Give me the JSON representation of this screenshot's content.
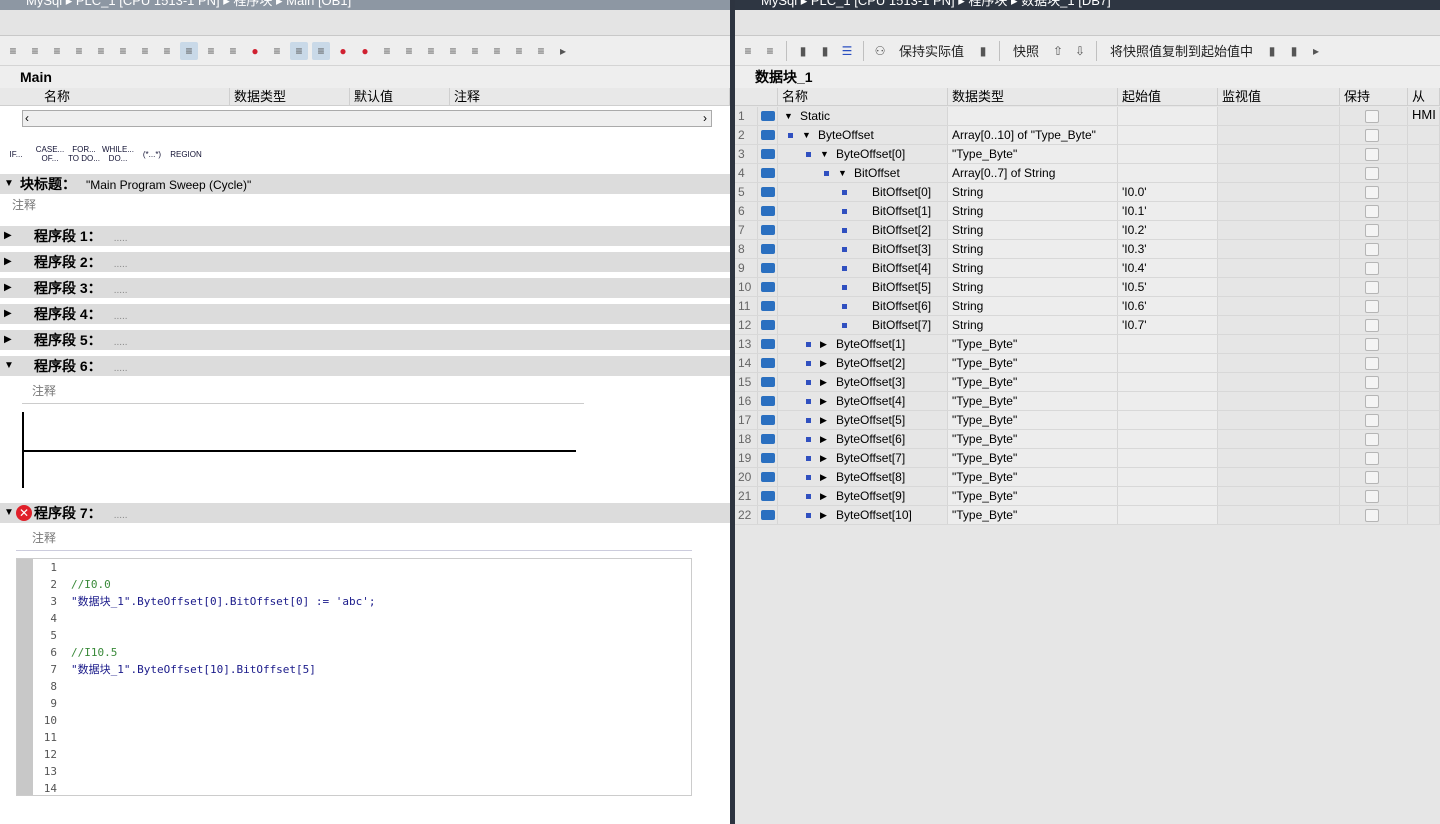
{
  "left": {
    "title": "MySql ▸ PLC_1 [CPU 1513-1 PN] ▸ 程序块 ▸ Main [OB1]",
    "block_name": "Main",
    "interface_headers": [
      "名称",
      "数据类型",
      "默认值",
      "注释"
    ],
    "snippets": [
      "IF...",
      "CASE... OF...",
      "FOR... TO DO...",
      "WHILE... DO...",
      "(*...*)",
      "REGION"
    ],
    "block_title_label": "块标题：",
    "block_title_value": "\"Main Program Sweep (Cycle)\"",
    "comment": "注释",
    "networks": [
      {
        "label": "程序段 1：",
        "dots": "....."
      },
      {
        "label": "程序段 2：",
        "dots": "....."
      },
      {
        "label": "程序段 3：",
        "dots": "....."
      },
      {
        "label": "程序段 4：",
        "dots": "....."
      },
      {
        "label": "程序段 5：",
        "dots": "....."
      },
      {
        "label": "程序段 6：",
        "dots": "....."
      },
      {
        "label": "程序段 7：",
        "dots": "....."
      }
    ],
    "code_lines": [
      "",
      "//I0.0",
      "\"数据块_1\".ByteOffset[0].BitOffset[0] := 'abc';",
      "",
      "",
      "//I10.5",
      "\"数据块_1\".ByteOffset[10].BitOffset[5]",
      "",
      "",
      "",
      "",
      "",
      "",
      ""
    ]
  },
  "right": {
    "title": "MySql ▸ PLC_1 [CPU 1513-1 PN] ▸ 程序块 ▸ 数据块_1 [DB7]",
    "block_name": "数据块_1",
    "toolbar_labels": {
      "keep_actual": "保持实际值",
      "snapshot": "快照",
      "copy_snapshot": "将快照值复制到起始值中"
    },
    "headers": [
      "名称",
      "数据类型",
      "起始值",
      "监视值",
      "保持",
      "从 HMI"
    ],
    "rows": [
      {
        "n": "1",
        "name": "Static",
        "type": "",
        "start": "",
        "lvl": 0,
        "exp": "down",
        "sq": false
      },
      {
        "n": "2",
        "name": "ByteOffset",
        "type": "Array[0..10] of \"Type_Byte\"",
        "start": "",
        "lvl": 1,
        "exp": "down",
        "sq": true
      },
      {
        "n": "3",
        "name": "ByteOffset[0]",
        "type": "\"Type_Byte\"",
        "start": "",
        "lvl": 2,
        "exp": "down",
        "sq": true
      },
      {
        "n": "4",
        "name": "BitOffset",
        "type": "Array[0..7] of String",
        "start": "",
        "lvl": 3,
        "exp": "down",
        "sq": true
      },
      {
        "n": "5",
        "name": "BitOffset[0]",
        "type": "String",
        "start": "'I0.0'",
        "lvl": 4,
        "exp": "",
        "sq": true
      },
      {
        "n": "6",
        "name": "BitOffset[1]",
        "type": "String",
        "start": "'I0.1'",
        "lvl": 4,
        "exp": "",
        "sq": true
      },
      {
        "n": "7",
        "name": "BitOffset[2]",
        "type": "String",
        "start": "'I0.2'",
        "lvl": 4,
        "exp": "",
        "sq": true
      },
      {
        "n": "8",
        "name": "BitOffset[3]",
        "type": "String",
        "start": "'I0.3'",
        "lvl": 4,
        "exp": "",
        "sq": true
      },
      {
        "n": "9",
        "name": "BitOffset[4]",
        "type": "String",
        "start": "'I0.4'",
        "lvl": 4,
        "exp": "",
        "sq": true
      },
      {
        "n": "10",
        "name": "BitOffset[5]",
        "type": "String",
        "start": "'I0.5'",
        "lvl": 4,
        "exp": "",
        "sq": true
      },
      {
        "n": "11",
        "name": "BitOffset[6]",
        "type": "String",
        "start": "'I0.6'",
        "lvl": 4,
        "exp": "",
        "sq": true
      },
      {
        "n": "12",
        "name": "BitOffset[7]",
        "type": "String",
        "start": "'I0.7'",
        "lvl": 4,
        "exp": "",
        "sq": true
      },
      {
        "n": "13",
        "name": "ByteOffset[1]",
        "type": "\"Type_Byte\"",
        "start": "",
        "lvl": 2,
        "exp": "right",
        "sq": true
      },
      {
        "n": "14",
        "name": "ByteOffset[2]",
        "type": "\"Type_Byte\"",
        "start": "",
        "lvl": 2,
        "exp": "right",
        "sq": true
      },
      {
        "n": "15",
        "name": "ByteOffset[3]",
        "type": "\"Type_Byte\"",
        "start": "",
        "lvl": 2,
        "exp": "right",
        "sq": true
      },
      {
        "n": "16",
        "name": "ByteOffset[4]",
        "type": "\"Type_Byte\"",
        "start": "",
        "lvl": 2,
        "exp": "right",
        "sq": true
      },
      {
        "n": "17",
        "name": "ByteOffset[5]",
        "type": "\"Type_Byte\"",
        "start": "",
        "lvl": 2,
        "exp": "right",
        "sq": true
      },
      {
        "n": "18",
        "name": "ByteOffset[6]",
        "type": "\"Type_Byte\"",
        "start": "",
        "lvl": 2,
        "exp": "right",
        "sq": true
      },
      {
        "n": "19",
        "name": "ByteOffset[7]",
        "type": "\"Type_Byte\"",
        "start": "",
        "lvl": 2,
        "exp": "right",
        "sq": true
      },
      {
        "n": "20",
        "name": "ByteOffset[8]",
        "type": "\"Type_Byte\"",
        "start": "",
        "lvl": 2,
        "exp": "right",
        "sq": true
      },
      {
        "n": "21",
        "name": "ByteOffset[9]",
        "type": "\"Type_Byte\"",
        "start": "",
        "lvl": 2,
        "exp": "right",
        "sq": true
      },
      {
        "n": "22",
        "name": "ByteOffset[10]",
        "type": "\"Type_Byte\"",
        "start": "",
        "lvl": 2,
        "exp": "right",
        "sq": true
      }
    ]
  },
  "colors": {
    "error": "#e0202a",
    "db_icon": "#2a6fc0",
    "network_bar": "#dcdcdc"
  }
}
